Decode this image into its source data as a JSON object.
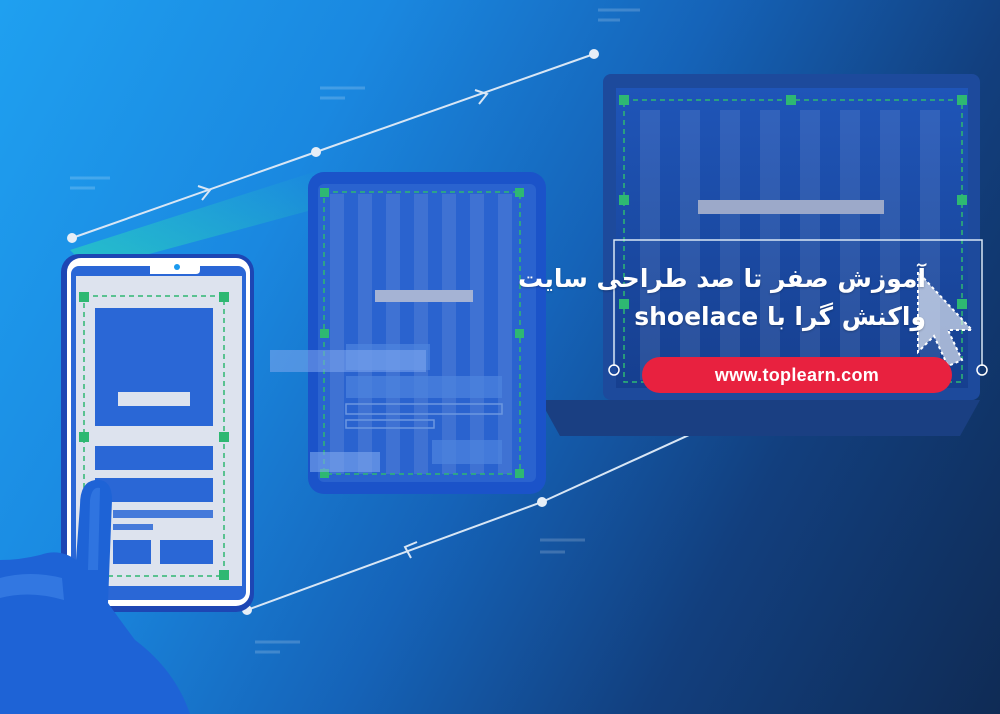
{
  "banner": {
    "title_line1": "آموزش صفر تا صد طراحی سایت",
    "title_line2": "واکنش گرا با shoelace",
    "url": "www.toplearn.com"
  },
  "colors": {
    "background_start": "#1fa0f0",
    "background_end": "#0f2b55",
    "accent_red": "#e8213f",
    "handle_green": "#2eb872",
    "device_blue": "#1b53c9"
  },
  "icons": {
    "hand": "pointing-hand-icon",
    "cursor": "arrow-cursor-icon"
  }
}
